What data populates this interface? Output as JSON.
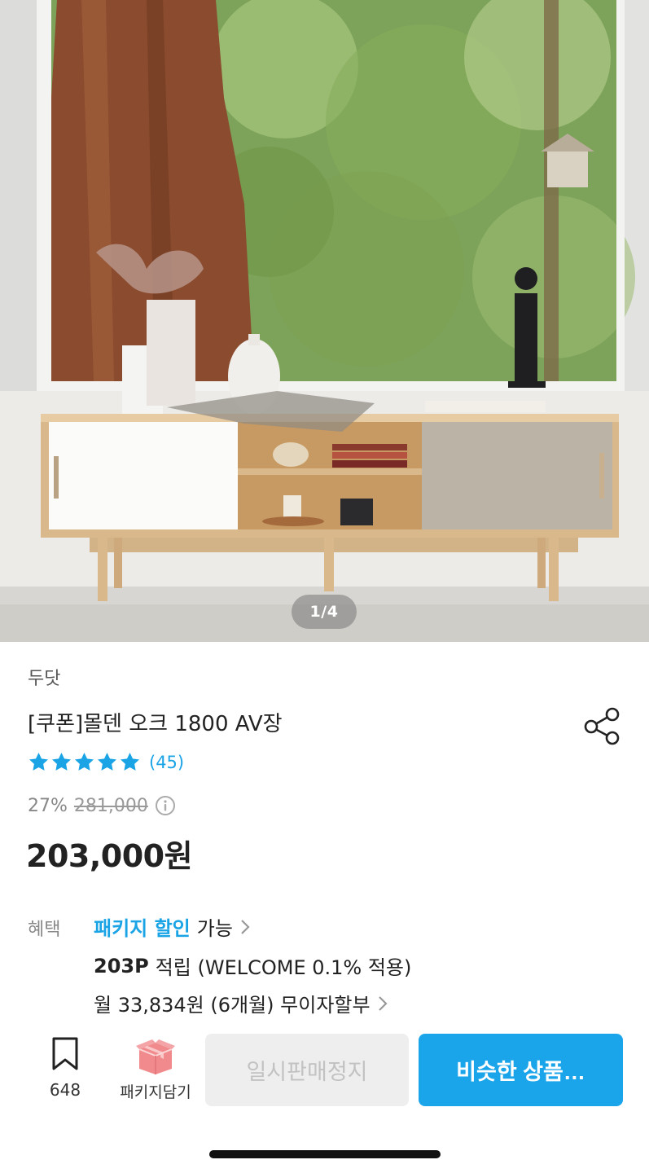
{
  "hero": {
    "pager": "1/4"
  },
  "product": {
    "brand": "두닷",
    "title": "[쿠폰]몰덴 오크 1800 AV장",
    "rating_stars": 5,
    "review_count": "(45)",
    "discount": "27%",
    "original_price": "281,000",
    "price": "203,000원"
  },
  "benefits": {
    "label": "혜택",
    "package_discount": "패키지 할인",
    "package_available": "가능",
    "points_bold": "203P",
    "points_text": "적립 (WELCOME 0.1% 적용)",
    "installment": "월 33,834원 (6개월) 무이자할부"
  },
  "bottom_bar": {
    "bookmark_count": "648",
    "package_label": "패키지담기",
    "disabled_button": "일시판매정지",
    "primary_button": "비슷한 상품…"
  },
  "icons": {
    "share": "share-icon",
    "star": "star-icon",
    "info": "info-icon",
    "chevron": "chevron-right-icon",
    "bookmark": "bookmark-icon",
    "package": "package-box-icon"
  },
  "colors": {
    "accent": "#1aa4ea",
    "text": "#222222",
    "muted": "#888888",
    "disabled_bg": "#eeeeee",
    "package_pink": "#f0868a"
  }
}
